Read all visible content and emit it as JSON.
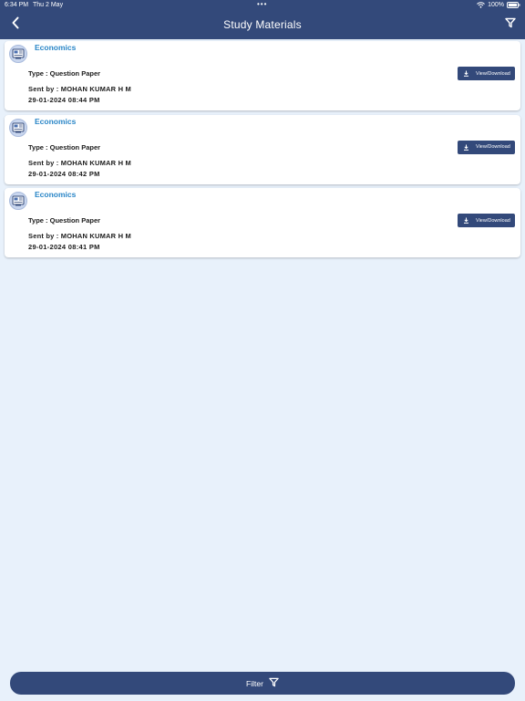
{
  "status_bar": {
    "time": "6:34 PM",
    "date": "Thu 2 May",
    "dots": "•••",
    "battery": "100%"
  },
  "header": {
    "title": "Study Materials"
  },
  "materials": [
    {
      "subject": "Economics",
      "type": "Type : Question Paper",
      "sender": "Sent by : MOHAN KUMAR H M",
      "datetime": "29-01-2024 08:44 PM",
      "action": "View/Download"
    },
    {
      "subject": "Economics",
      "type": "Type : Question Paper",
      "sender": "Sent by : MOHAN KUMAR H M",
      "datetime": "29-01-2024 08:42 PM",
      "action": "View/Download"
    },
    {
      "subject": "Economics",
      "type": "Type : Question Paper",
      "sender": "Sent by : MOHAN KUMAR H M",
      "datetime": "29-01-2024 08:41 PM",
      "action": "View/Download"
    }
  ],
  "bottom_bar": {
    "filter_label": "Filter"
  },
  "colors": {
    "primary": "#33497a",
    "accent": "#2a86c7",
    "background": "#e8f1fb"
  },
  "icons": {
    "back": "chevron-left-icon",
    "filter": "filter-icon",
    "download": "download-icon",
    "avatar": "document-icon"
  }
}
